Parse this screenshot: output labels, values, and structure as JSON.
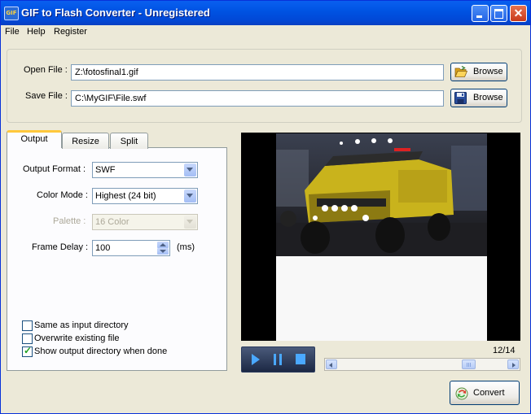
{
  "window": {
    "title": "GIF to Flash Converter - Unregistered",
    "icon_text": "GIF"
  },
  "menu": [
    "File",
    "Help",
    "Register"
  ],
  "open_file": {
    "label": "Open File :",
    "value": "Z:\\fotosfinal1.gif",
    "browse_label": "Browse"
  },
  "save_file": {
    "label": "Save File :",
    "value": "C:\\MyGIF\\File.swf",
    "browse_label": "Browse"
  },
  "tabs": [
    {
      "label": "Output",
      "active": true
    },
    {
      "label": "Resize",
      "active": false
    },
    {
      "label": "Split",
      "active": false
    }
  ],
  "output": {
    "format_label": "Output Format :",
    "format_value": "SWF",
    "color_label": "Color Mode :",
    "color_value": "Highest (24 bit)",
    "palette_label": "Palette :",
    "palette_value": "16 Color",
    "delay_label": "Frame Delay :",
    "delay_value": "100",
    "delay_unit": "(ms)"
  },
  "options": [
    {
      "label": "Same as input directory",
      "checked": false
    },
    {
      "label": "Overwrite existing file",
      "checked": false
    },
    {
      "label": "Show output directory when done",
      "checked": true
    }
  ],
  "player": {
    "frame_counter": "12/14",
    "scroll_position": 0.8
  },
  "convert_label": "Convert",
  "colors": {
    "titlebar": "#0054e3",
    "window_bg": "#ece9d8",
    "tab_highlight": "#ffc83c",
    "player_bg": "#1c2844"
  },
  "icons": {
    "open": "open-folder-icon",
    "save": "floppy-disk-icon",
    "convert": "convert-icon"
  }
}
